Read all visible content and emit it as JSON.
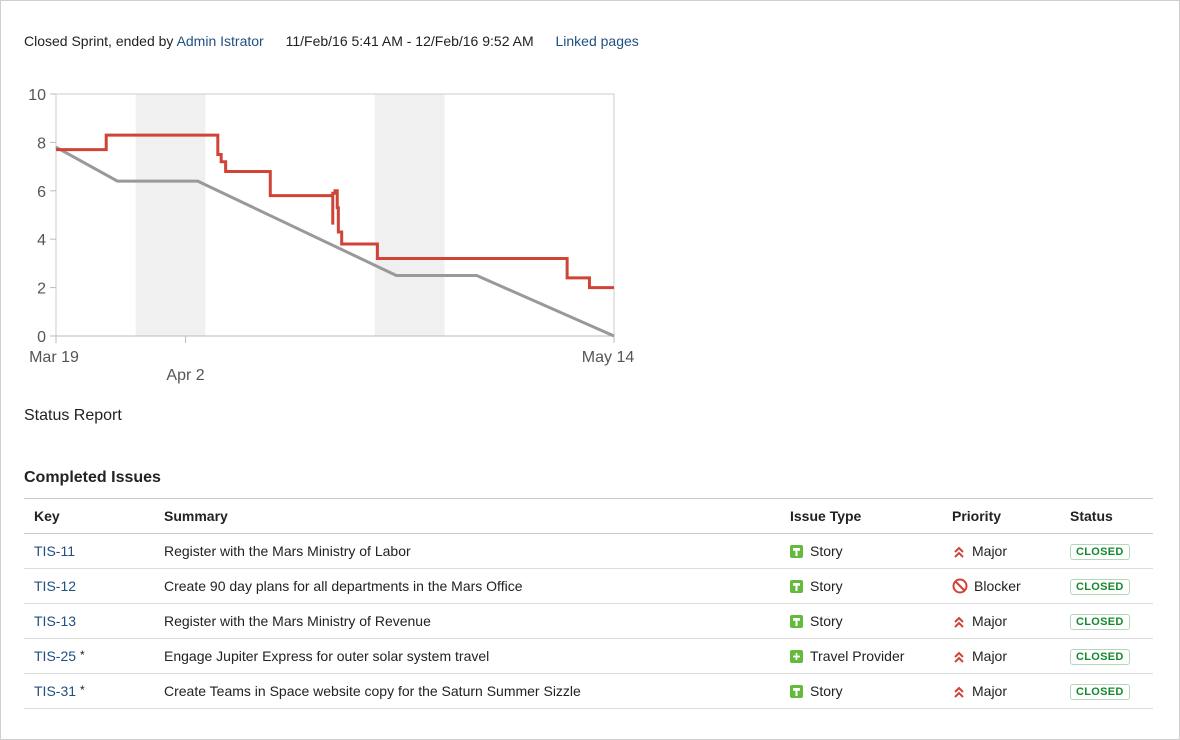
{
  "header": {
    "prefix": "Closed Sprint, ended by",
    "user": "Admin Istrator",
    "dates": "11/Feb/16 5:41 AM - 12/Feb/16 9:52 AM",
    "linked_pages": "Linked pages"
  },
  "chart_data": {
    "type": "line",
    "title": "",
    "xlabel": "",
    "ylabel": "",
    "ylim": [
      0,
      10
    ],
    "y_ticks": [
      "0",
      "2",
      "4",
      "6",
      "8",
      "10"
    ],
    "x_labels": [
      "Mar 19",
      "Apr 2",
      "May 14"
    ],
    "x_range": [
      "Mar 19",
      "May 14"
    ],
    "non_working_bands": [
      [
        "Mar 27",
        "Apr 3"
      ],
      [
        "Apr 21",
        "Apr 28"
      ]
    ],
    "grid": false,
    "series": [
      {
        "color": "#d04437",
        "x_days": [
          0,
          0,
          4.5,
          4.5,
          14.5,
          14.5,
          14.8,
          14.8,
          15.2,
          15.2,
          19.2,
          19.2,
          24.8,
          24.8,
          24.8,
          25,
          25,
          25.2,
          25.2,
          25.3,
          25.3,
          25.6,
          25.6,
          26.3,
          26.3,
          28.8,
          28.8,
          45.8,
          45.8,
          47.8,
          47.8,
          50
        ],
        "values": [
          7.7,
          7.7,
          7.7,
          8.3,
          8.3,
          7.5,
          7.5,
          7.2,
          7.2,
          6.8,
          6.8,
          5.8,
          5.8,
          4.6,
          5.9,
          5.9,
          6.0,
          6.0,
          5.3,
          5.3,
          4.3,
          4.3,
          3.8,
          3.8,
          3.8,
          3.8,
          3.2,
          3.2,
          2.4,
          2.4,
          2.0,
          2.0
        ]
      },
      {
        "color": "#999999",
        "x_days": [
          0,
          5.5,
          12.7,
          30.5,
          37.7,
          50
        ],
        "values": [
          7.8,
          6.4,
          6.4,
          2.5,
          2.5,
          0
        ]
      }
    ]
  },
  "status_report": "Status Report",
  "completed_title": "Completed Issues",
  "table": {
    "headers": {
      "key": "Key",
      "summary": "Summary",
      "type": "Issue Type",
      "priority": "Priority",
      "status": "Status"
    },
    "rows": [
      {
        "key": "TIS-11",
        "star": "",
        "summary": "Register with the Mars Ministry of Labor",
        "type": "Story",
        "type_icon": "story-icon",
        "priority": "Major",
        "priority_icon": "major-priority-icon",
        "status": "CLOSED"
      },
      {
        "key": "TIS-12",
        "star": "",
        "summary": "Create 90 day plans for all departments in the Mars Office",
        "type": "Story",
        "type_icon": "story-icon",
        "priority": "Blocker",
        "priority_icon": "blocker-priority-icon",
        "status": "CLOSED"
      },
      {
        "key": "TIS-13",
        "star": "",
        "summary": "Register with the Mars Ministry of Revenue",
        "type": "Story",
        "type_icon": "story-icon",
        "priority": "Major",
        "priority_icon": "major-priority-icon",
        "status": "CLOSED"
      },
      {
        "key": "TIS-25",
        "star": "*",
        "summary": "Engage Jupiter Express for outer solar system travel",
        "type": "Travel Provider",
        "type_icon": "travel-provider-icon",
        "priority": "Major",
        "priority_icon": "major-priority-icon",
        "status": "CLOSED"
      },
      {
        "key": "TIS-31",
        "star": "*",
        "summary": "Create Teams in Space website copy for the Saturn Summer Sizzle",
        "type": "Story",
        "type_icon": "story-icon",
        "priority": "Major",
        "priority_icon": "major-priority-icon",
        "status": "CLOSED"
      }
    ]
  }
}
